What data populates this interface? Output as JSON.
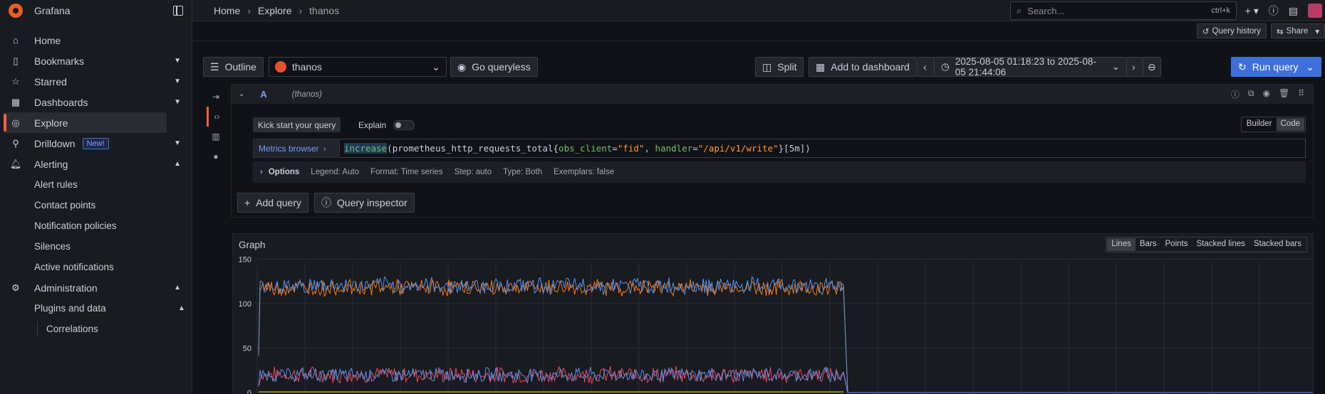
{
  "app": {
    "name": "Grafana"
  },
  "sidebar": {
    "items": [
      {
        "label": "Home",
        "icon": "home-icon"
      },
      {
        "label": "Bookmarks",
        "icon": "bookmark-icon",
        "expandable": true
      },
      {
        "label": "Starred",
        "icon": "star-icon",
        "expandable": true
      },
      {
        "label": "Dashboards",
        "icon": "apps-icon",
        "expandable": true
      },
      {
        "label": "Explore",
        "icon": "compass-icon",
        "active": true
      },
      {
        "label": "Drilldown",
        "icon": "drilldown-icon",
        "badge": "New!",
        "expandable": true
      },
      {
        "label": "Alerting",
        "icon": "bell-icon",
        "expanded": true
      }
    ],
    "alerting_children": [
      "Alert rules",
      "Contact points",
      "Notification policies",
      "Silences",
      "Active notifications"
    ],
    "administration": {
      "label": "Administration",
      "icon": "cog-icon"
    },
    "plugins_and_data": {
      "label": "Plugins and data"
    },
    "correlations": {
      "label": "Correlations"
    }
  },
  "breadcrumb": [
    "Home",
    "Explore",
    "thanos"
  ],
  "search": {
    "placeholder": "Search...",
    "shortcut": "ctrl+k"
  },
  "subbar": {
    "query_history": "Query history",
    "share": "Share"
  },
  "toolbar": {
    "outline": "Outline",
    "datasource": "thanos",
    "go_queryless": "Go queryless",
    "split": "Split",
    "add_to_dashboard": "Add to dashboard",
    "time_range": "2025-08-05 01:18:23 to 2025-08-05 21:44:06",
    "run_query": "Run query"
  },
  "query": {
    "letter": "A",
    "datasource": "(thanos)",
    "kick_start": "Kick start your query",
    "explain": "Explain",
    "mode_builder": "Builder",
    "mode_code": "Code",
    "metrics_browser": "Metrics browser",
    "expr": {
      "fn": "increase",
      "metric": "(prometheus_http_requests_total{",
      "l1": "obs_client",
      "eq1": "=",
      "v1": "\"fid\"",
      "comma": ", ",
      "l2": "handler",
      "eq2": "=",
      "v2": "\"/api/v1/write\"",
      "tail": "}[5m])"
    },
    "options": {
      "title": "Options",
      "legend": "Legend: Auto",
      "format": "Format: Time series",
      "step": "Step: auto",
      "type": "Type: Both",
      "exemplars": "Exemplars: false"
    },
    "add_query": "Add query",
    "query_inspector": "Query inspector"
  },
  "graph": {
    "title": "Graph",
    "viz_options": [
      "Lines",
      "Bars",
      "Points",
      "Stacked lines",
      "Stacked bars"
    ],
    "selected": "Lines"
  },
  "chart_data": {
    "type": "line",
    "title": "Graph",
    "yticks": [
      0,
      50,
      100,
      150
    ],
    "ylim": [
      0,
      160
    ],
    "grid": true,
    "series": [
      {
        "color": "#5794f2",
        "level_mean": 120,
        "level_noise": 8,
        "low_mean": 20,
        "low_noise": 7
      },
      {
        "color": "#ff780a",
        "level_mean": 118,
        "level_noise": 8
      },
      {
        "color": "#f2495c",
        "low_mean": 20,
        "low_noise": 8
      },
      {
        "color": "#fade2a",
        "flat": 0
      }
    ]
  },
  "colors": {
    "accent": "#3d71d9",
    "brand": "#f05a28",
    "active_marker": "#f55f3e"
  }
}
